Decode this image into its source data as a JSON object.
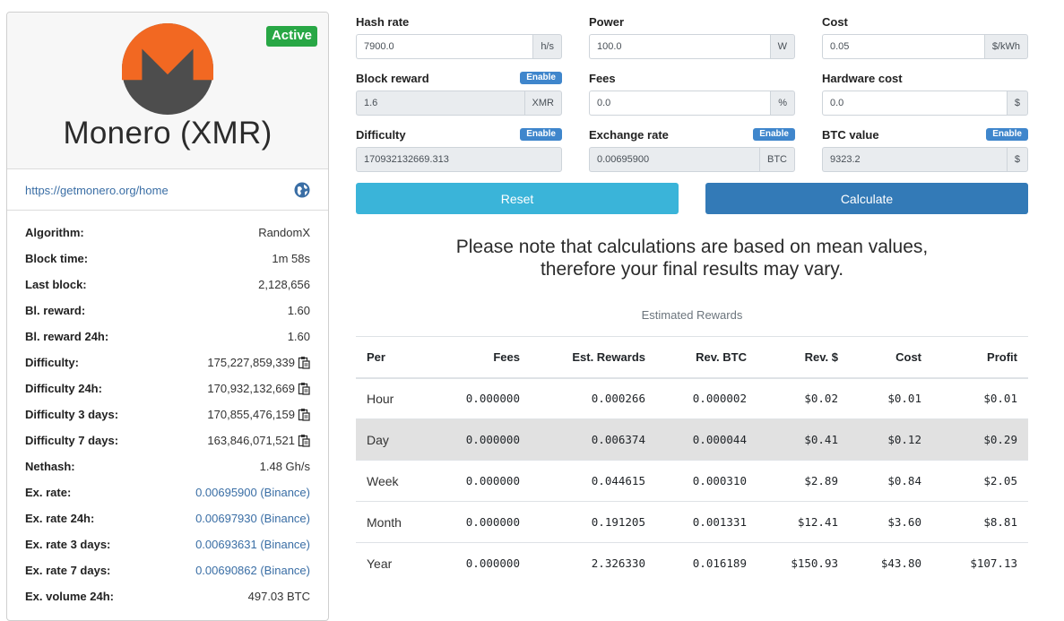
{
  "coin": {
    "status": "Active",
    "title": "Monero (XMR)",
    "url": "https://getmonero.org/home",
    "stats": [
      {
        "label": "Algorithm:",
        "value": "RandomX"
      },
      {
        "label": "Block time:",
        "value": "1m 58s"
      },
      {
        "label": "Last block:",
        "value": "2,128,656"
      },
      {
        "label": "Bl. reward:",
        "value": "1.60"
      },
      {
        "label": "Bl. reward 24h:",
        "value": "1.60"
      },
      {
        "label": "Difficulty:",
        "value": "175,227,859,339"
      },
      {
        "label": "Difficulty 24h:",
        "value": "170,932,132,669"
      },
      {
        "label": "Difficulty 3 days:",
        "value": "170,855,476,159"
      },
      {
        "label": "Difficulty 7 days:",
        "value": "163,846,071,521"
      },
      {
        "label": "Nethash:",
        "value": "1.48 Gh/s"
      },
      {
        "label": "Ex. rate:",
        "value": "0.00695900 (Binance)"
      },
      {
        "label": "Ex. rate 24h:",
        "value": "0.00697930 (Binance)"
      },
      {
        "label": "Ex. rate 3 days:",
        "value": "0.00693631 (Binance)"
      },
      {
        "label": "Ex. rate 7 days:",
        "value": "0.00690862 (Binance)"
      },
      {
        "label": "Ex. volume 24h:",
        "value": "497.03 BTC"
      }
    ]
  },
  "form": {
    "enable_label": "Enable",
    "hash_rate": {
      "label": "Hash rate",
      "value": "7900.0",
      "unit": "h/s"
    },
    "power": {
      "label": "Power",
      "value": "100.0",
      "unit": "W"
    },
    "cost": {
      "label": "Cost",
      "value": "0.05",
      "unit": "$/kWh"
    },
    "block_reward": {
      "label": "Block reward",
      "value": "1.6",
      "unit": "XMR"
    },
    "fees": {
      "label": "Fees",
      "value": "0.0",
      "unit": "%"
    },
    "hardware_cost": {
      "label": "Hardware cost",
      "value": "0.0",
      "unit": "$"
    },
    "difficulty": {
      "label": "Difficulty",
      "value": "170932132669.313"
    },
    "exchange_rate": {
      "label": "Exchange rate",
      "value": "0.00695900",
      "unit": "BTC"
    },
    "btc_value": {
      "label": "BTC value",
      "value": "9323.2",
      "unit": "$"
    },
    "reset_label": "Reset",
    "calculate_label": "Calculate"
  },
  "note": {
    "line1": "Please note that calculations are based on mean values,",
    "line2": "therefore your final results may vary."
  },
  "rewards": {
    "caption": "Estimated Rewards",
    "headers": [
      "Per",
      "Fees",
      "Est. Rewards",
      "Rev. BTC",
      "Rev. $",
      "Cost",
      "Profit"
    ],
    "rows": [
      [
        "Hour",
        "0.000000",
        "0.000266",
        "0.000002",
        "$0.02",
        "$0.01",
        "$0.01"
      ],
      [
        "Day",
        "0.000000",
        "0.006374",
        "0.000044",
        "$0.41",
        "$0.12",
        "$0.29"
      ],
      [
        "Week",
        "0.000000",
        "0.044615",
        "0.000310",
        "$2.89",
        "$0.84",
        "$2.05"
      ],
      [
        "Month",
        "0.000000",
        "0.191205",
        "0.001331",
        "$12.41",
        "$3.60",
        "$8.81"
      ],
      [
        "Year",
        "0.000000",
        "2.326330",
        "0.016189",
        "$150.93",
        "$43.80",
        "$107.13"
      ]
    ]
  },
  "colors": {
    "brand_orange": "#f26822",
    "brand_gray": "#4d4d4d",
    "active": "#28a745",
    "primary": "#337ab7",
    "info": "#3ab4d9"
  }
}
